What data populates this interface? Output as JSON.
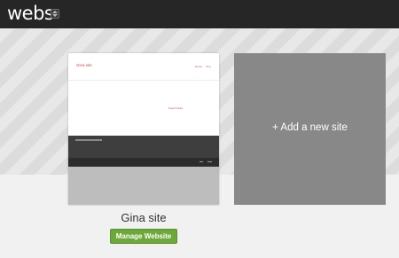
{
  "app": {
    "logo_text": "webs"
  },
  "header": {
    "switcher_icon": "updown-caret-icon"
  },
  "sites": [
    {
      "name": "Gina site",
      "manage_label": "Manage Website",
      "thumbnail": {
        "title": "Gina site",
        "nav": [
          "Home",
          "Blog"
        ],
        "badge": "Search Foldes"
      }
    }
  ],
  "add_site": {
    "label": "+ Add a new site"
  },
  "colors": {
    "topbar": "#262626",
    "manage_button": "#6da83b",
    "add_card": "#888888",
    "accent_red": "#c94b4b"
  }
}
